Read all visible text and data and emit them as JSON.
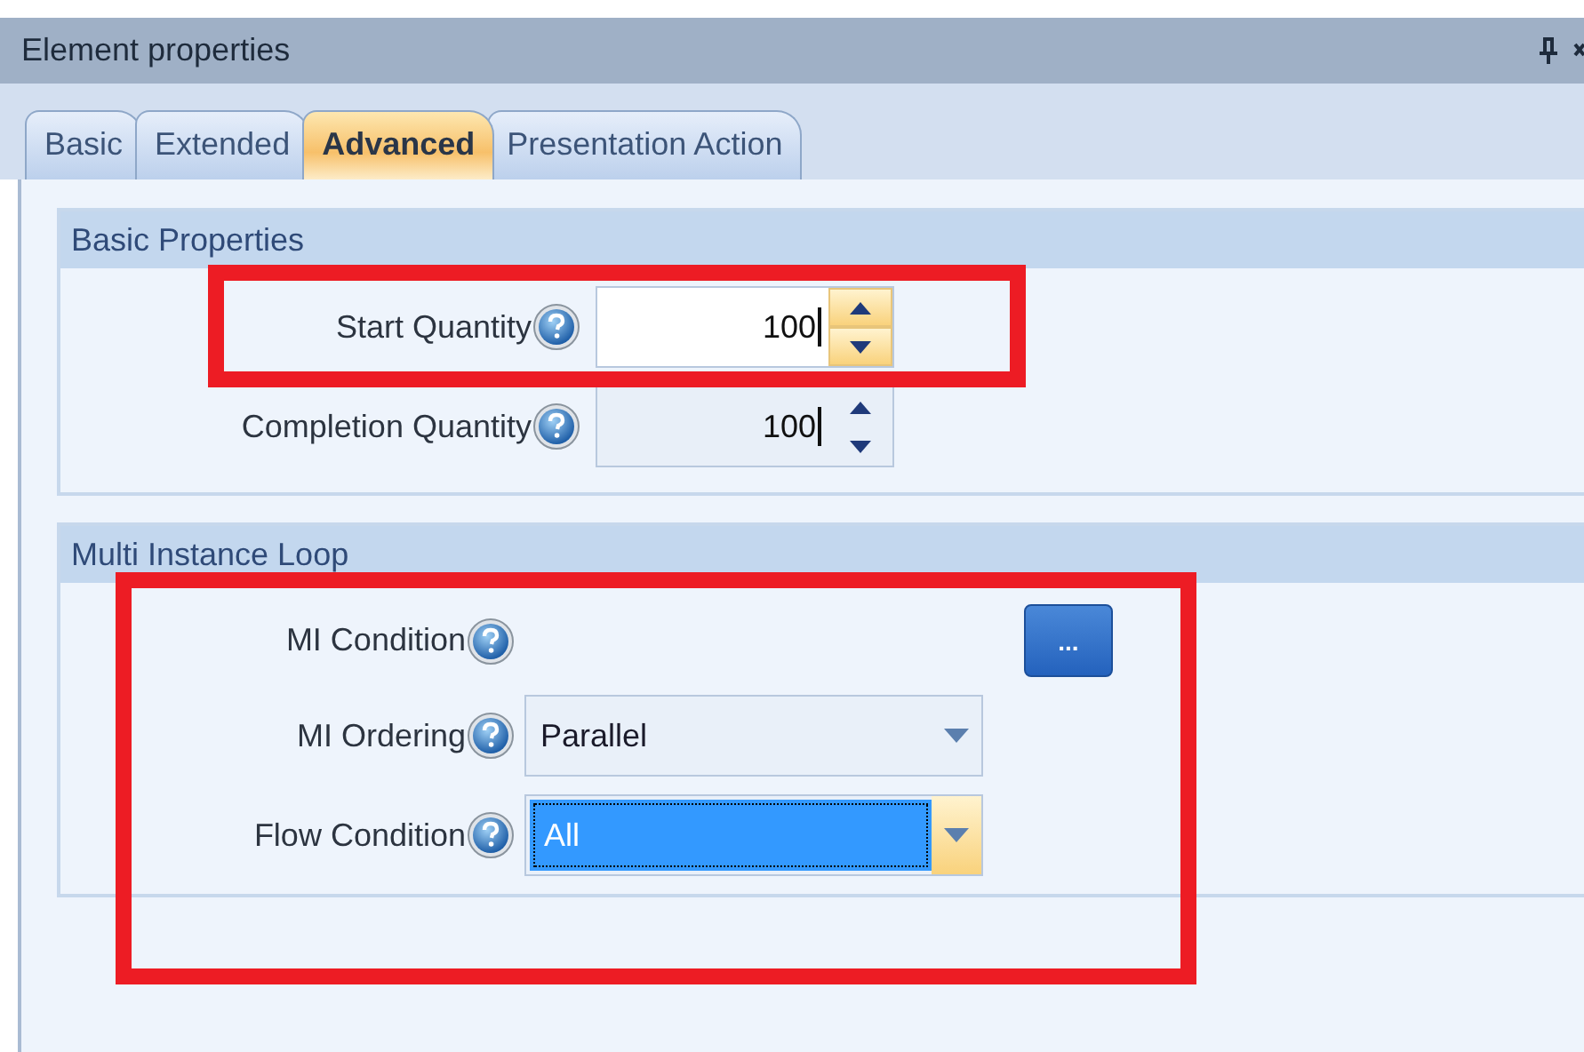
{
  "window": {
    "title": "Element properties"
  },
  "tabs": [
    {
      "label": "Basic",
      "selected": false
    },
    {
      "label": "Extended",
      "selected": false
    },
    {
      "label": "Advanced",
      "selected": true
    },
    {
      "label": "Presentation Action",
      "selected": false
    }
  ],
  "groups": [
    {
      "title": "Basic Properties",
      "fields": [
        {
          "kind": "spinner",
          "label": "Start Quantity",
          "value": "100",
          "focused": true
        },
        {
          "kind": "spinner",
          "label": "Completion Quantity",
          "value": "100",
          "focused": false
        }
      ]
    },
    {
      "title": "Multi Instance Loop",
      "fields": [
        {
          "kind": "ellipsis",
          "label": "MI Condition",
          "button": "..."
        },
        {
          "kind": "dropdown",
          "label": "MI Ordering",
          "value": "Parallel",
          "focused": false
        },
        {
          "kind": "dropdown",
          "label": "Flow Condition",
          "value": "All",
          "focused": true
        }
      ]
    }
  ]
}
